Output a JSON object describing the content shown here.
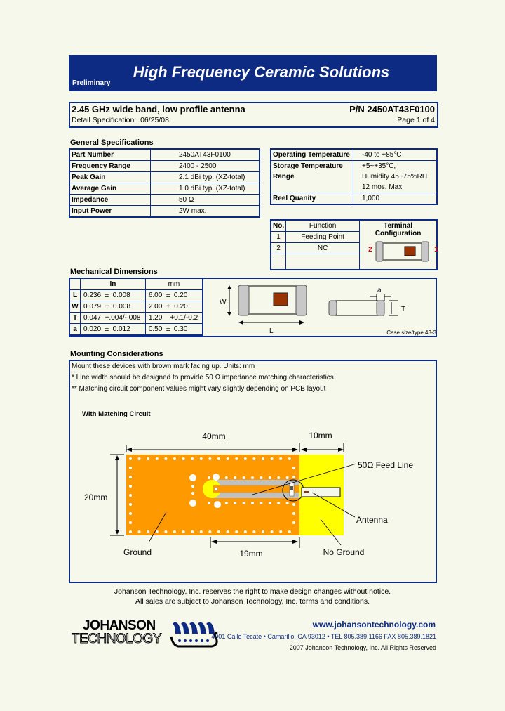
{
  "header": {
    "title": "High Frequency Ceramic Solutions",
    "status": "Preliminary",
    "brand_color": "#0d2b83"
  },
  "doc": {
    "title": "2.45 GHz wide band, low profile antenna",
    "part_number_label": "P/N 2450AT43F0100",
    "spec_label": "Detail Specification:",
    "spec_date": "06/25/08",
    "page": "Page 1 of 4"
  },
  "general_specs": {
    "heading": "General Specifications",
    "rows": [
      {
        "label": "Part Number",
        "value": "2450AT43F0100"
      },
      {
        "label": "Frequency Range",
        "value": "2400 - 2500"
      },
      {
        "label": "Peak Gain",
        "value": "2.1  dBi typ. (XZ-total)"
      },
      {
        "label": "Average Gain",
        "value": "1.0  dBi typ. (XZ-total)"
      },
      {
        "label": "Impedance",
        "value": "50 Ω"
      },
      {
        "label": "Input Power",
        "value": "2W max."
      }
    ]
  },
  "env_specs": {
    "rows": [
      {
        "label": "Operating Temperature",
        "value": [
          "-40 to +85°C"
        ]
      },
      {
        "label": "Storage Temperature Range",
        "value": [
          "+5~+35°C,",
          "Humidity 45~75%RH",
          "12 mos. Max"
        ]
      },
      {
        "label": "Reel Quanity",
        "value": [
          "1,000"
        ]
      }
    ]
  },
  "terminals": {
    "headers": [
      "No.",
      "Function",
      "Terminal Configuration"
    ],
    "rows": [
      {
        "no": "1",
        "function": "Feeding Point"
      },
      {
        "no": "2",
        "function": "NC"
      }
    ],
    "left_pin": "2",
    "right_pin": "1"
  },
  "mechanical": {
    "heading": "Mechanical Dimensions",
    "headers": [
      "",
      "In",
      "mm"
    ],
    "rows": [
      {
        "dim": "L",
        "in": "0.236  ±  0.008",
        "mm": "6.00  ±  0.20"
      },
      {
        "dim": "W",
        "in": "0.079  +  0.008",
        "mm": "2.00  +  0.20"
      },
      {
        "dim": "T",
        "in": "0.047  +.004/-.008",
        "mm": "1.20    +0.1/-0.2"
      },
      {
        "dim": "a",
        "in": "0.020  ±  0.012",
        "mm": "0.50  ±  0.30"
      }
    ],
    "labels": {
      "w": "W",
      "l": "L",
      "a": "a",
      "t": "T"
    },
    "case_note": "Case size/type 43-3"
  },
  "mounting": {
    "heading": "Mounting Considerations",
    "lines": [
      "Mount these devices with brown mark facing up. Units: mm",
      "* Line width should be designed to provide 50 Ω impedance matching characteristics.",
      "** Matching circuit component values might vary slightly depending on PCB layout"
    ],
    "diagram_title": "With Matching Circuit",
    "dim_40": "40mm",
    "dim_10": "10mm",
    "dim_20": "20mm",
    "dim_19": "19mm",
    "label_feed": "50Ω Feed Line",
    "label_antenna": "Antenna",
    "label_ground": "Ground",
    "label_noground": "No Ground",
    "ground_color": "#ff9900",
    "noground_color": "#ffff00"
  },
  "footer": {
    "notice1": "Johanson Technology, Inc. reserves the right to make design changes without notice.",
    "notice2": "All sales are subject to Johanson Technology, Inc. terms and conditions.",
    "logo_line1": "JOHANSON",
    "logo_line2": "TECHNOLOGY",
    "url": "www.johansontechnology.com",
    "address": "4001 Calle Tecate • Camarillo, CA 93012 • TEL 805.389.1166 FAX 805.389.1821",
    "copyright": "2007 Johanson Technology, Inc.  All Rights Reserved"
  }
}
